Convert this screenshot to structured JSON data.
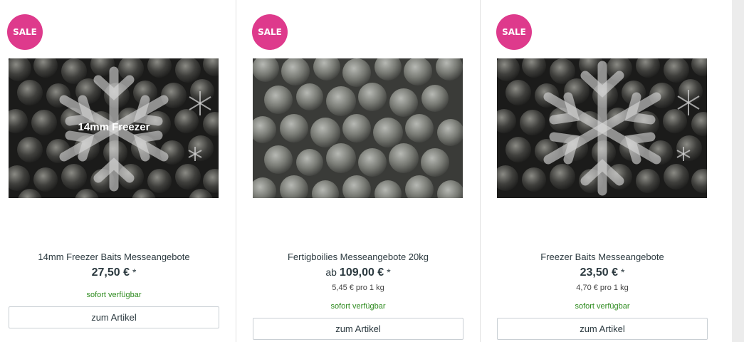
{
  "products": [
    {
      "badge": "SALE",
      "image_caption": "14mm Freezer",
      "title": "14mm Freezer Baits Messeangebote",
      "price_prefix": "",
      "price": "27,50 €",
      "price_star": "*",
      "unit_price": "",
      "availability": "sofort verfügbar",
      "button": "zum Artikel"
    },
    {
      "badge": "SALE",
      "image_caption": "",
      "title": "Fertigboilies Messeangebote 20kg",
      "price_prefix": "ab",
      "price": "109,00 €",
      "price_star": "*",
      "unit_price": "5,45 € pro 1 kg",
      "availability": "sofort verfügbar",
      "button": "zum Artikel"
    },
    {
      "badge": "SALE",
      "image_caption": "",
      "title": "Freezer Baits Messeangebote",
      "price_prefix": "",
      "price": "23,50 €",
      "price_star": "*",
      "unit_price": "4,70 € pro 1 kg",
      "availability": "sofort verfügbar",
      "button": "zum Artikel"
    }
  ],
  "colors": {
    "sale_badge": "#de3a8c",
    "availability": "#2e8b1f",
    "text": "#2c3a40"
  },
  "icons": {
    "snowflake_overlay": "snowflake-icon"
  }
}
